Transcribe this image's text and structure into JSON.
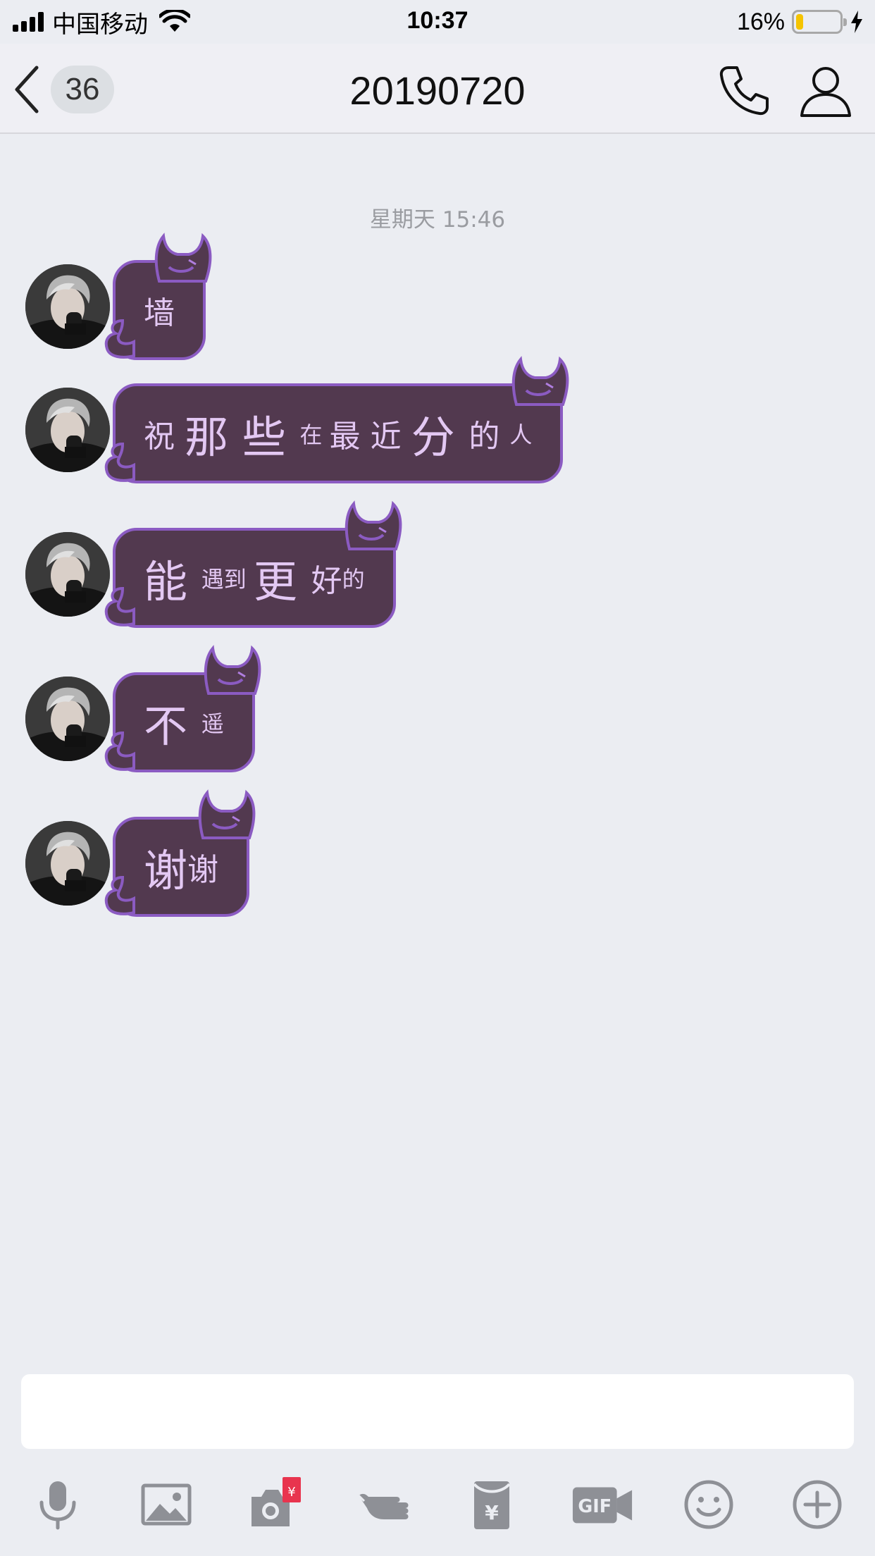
{
  "status_bar": {
    "carrier": "中国移动",
    "time": "10:37",
    "battery_percent": "16%",
    "battery_level": 0.16,
    "signal_bars": 4
  },
  "nav": {
    "back_count": "36",
    "title": "20190720"
  },
  "timestamp": "星期天 15:46",
  "messages": [
    {
      "segments": [
        {
          "text": "墙",
          "size": "med"
        }
      ]
    },
    {
      "segments": [
        {
          "text": "祝 ",
          "size": "med"
        },
        {
          "text": "那 ",
          "size": "big"
        },
        {
          "text": "些 ",
          "size": "big"
        },
        {
          "text": "在 ",
          "size": "sm"
        },
        {
          "text": "最 ",
          "size": "med"
        },
        {
          "text": "近 ",
          "size": "med"
        },
        {
          "text": "分 ",
          "size": "big"
        },
        {
          "text": "的 ",
          "size": "med"
        },
        {
          "text": "人",
          "size": "sm"
        }
      ]
    },
    {
      "segments": [
        {
          "text": "能 ",
          "size": "big"
        },
        {
          "text": "遇到 ",
          "size": "sm"
        },
        {
          "text": "更 ",
          "size": "big"
        },
        {
          "text": "好",
          "size": "med"
        },
        {
          "text": "的",
          "size": "sm"
        }
      ]
    },
    {
      "segments": [
        {
          "text": "不 ",
          "size": "big"
        },
        {
          "text": "遥",
          "size": "sm"
        }
      ]
    },
    {
      "segments": [
        {
          "text": "谢",
          "size": "big"
        },
        {
          "text": "谢",
          "size": "med"
        }
      ]
    }
  ],
  "toolbar": {
    "icons": [
      "microphone-icon",
      "image-icon",
      "camera-redpacket-icon",
      "poke-hand-icon",
      "red-envelope-icon",
      "gif-icon",
      "emoji-icon",
      "plus-icon"
    ],
    "red_packet_symbol": "¥",
    "envelope_symbol": "¥",
    "gif_label": "GIF"
  },
  "colors": {
    "background": "#ebedf2",
    "bubble_fill": "#52394f",
    "bubble_border": "#8b5bc2",
    "bubble_text": "#e3c8f3",
    "toolbar_icon": "#8e9096",
    "battery_fill": "#f5c400",
    "red_packet": "#e8344e"
  }
}
